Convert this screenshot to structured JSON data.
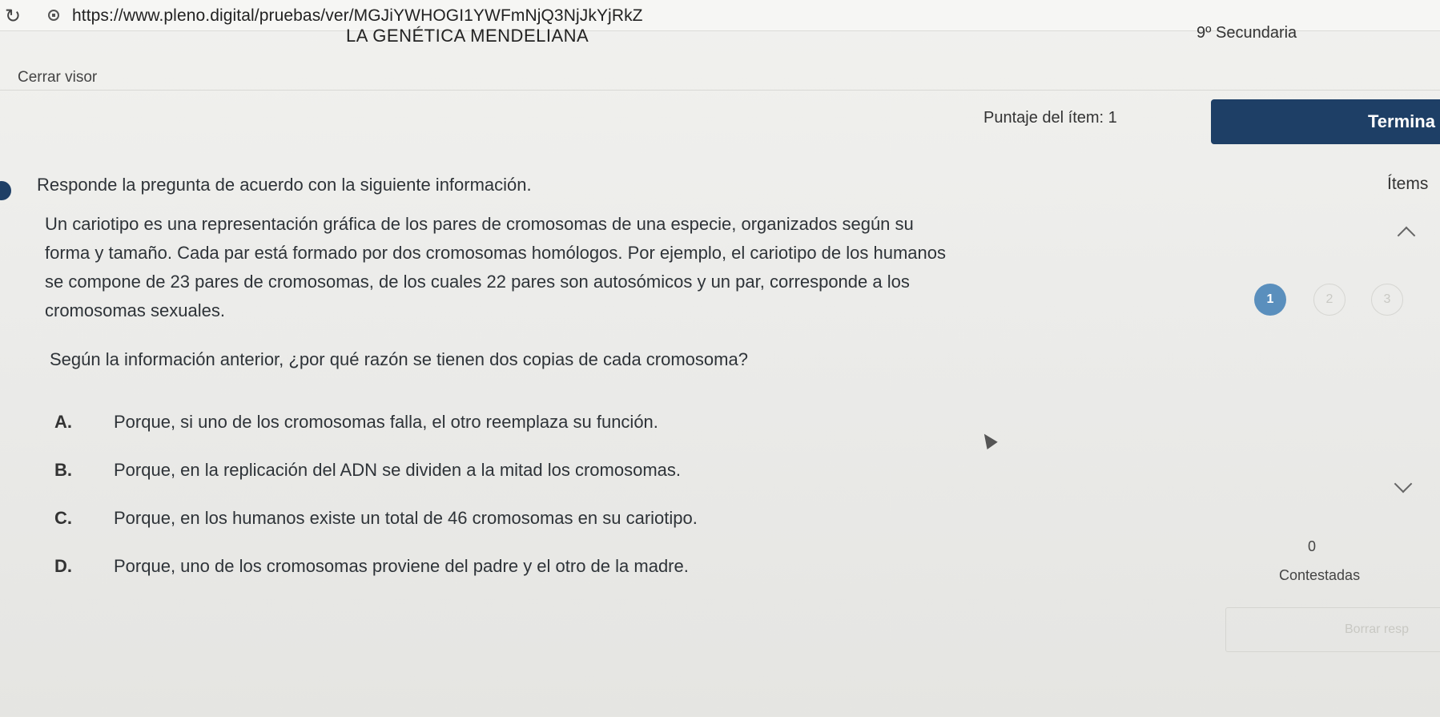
{
  "browser": {
    "url": "https://www.pleno.digital/pruebas/ver/MGJiYWHOGI1YWFmNjQ3NjJkYjRkZ"
  },
  "header": {
    "title": "LA GENÉTICA MENDELIANA",
    "grade": "9º Secundaria",
    "close_label": "Cerrar visor"
  },
  "score": {
    "label": "Puntaje del ítem: 1",
    "finish_label": "Termina"
  },
  "sidebar": {
    "items_label": "Ítems",
    "nav": [
      "1",
      "2",
      "3"
    ],
    "answered_count": "0",
    "answered_label": "Contestadas",
    "erase_label": "Borrar resp"
  },
  "content": {
    "instruction": "Responde la pregunta de acuerdo con la siguiente información.",
    "passage_lines": [
      "Un cariotipo es una representación gráfica de los pares de cromosomas de una especie, organizados según su",
      "forma y tamaño. Cada par está formado por dos cromosomas homólogos. Por ejemplo, el cariotipo de los humanos",
      "se compone de 23 pares de cromosomas, de los cuales 22 pares son autosómicos y un par, corresponde a los",
      "cromosomas sexuales."
    ],
    "question": "Según la información anterior, ¿por qué razón se tienen dos copias de cada cromosoma?",
    "options": [
      {
        "letter": "A.",
        "text": "Porque, si uno de los cromosomas falla, el otro reemplaza su función."
      },
      {
        "letter": "B.",
        "text": "Porque, en la replicación del ADN se dividen a la mitad los cromosomas."
      },
      {
        "letter": "C.",
        "text": "Porque, en los humanos existe un total de 46 cromosomas en su cariotipo."
      },
      {
        "letter": "D.",
        "text": "Porque, uno de los cromosomas proviene del padre y el otro de la madre."
      }
    ]
  },
  "colors": {
    "primary": "#1e3f66",
    "active_dot": "#5a8fbd"
  },
  "icons": [
    "reload-icon",
    "lock-icon",
    "chevron-up-icon",
    "chevron-down-icon",
    "cursor-icon"
  ]
}
